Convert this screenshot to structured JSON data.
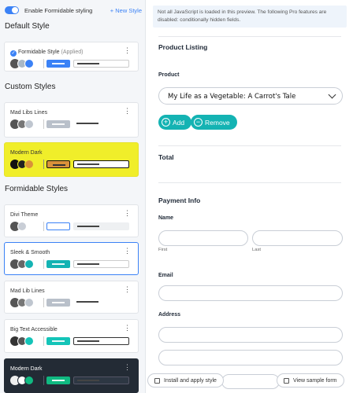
{
  "sidebar": {
    "toggle_label": "Enable Formidable styling",
    "new_style": "+ New Style",
    "default_title": "Default Style",
    "custom_title": "Custom Styles",
    "formidable_title": "Formidable Styles",
    "default_card": {
      "name": "Formidable Style",
      "applied": "(Applied)"
    },
    "custom_cards": [
      {
        "name": "Mad Libs Lines"
      },
      {
        "name": "Modern Dark"
      }
    ],
    "formidable_cards": [
      {
        "name": "Divi Theme"
      },
      {
        "name": "Sleek & Smooth"
      },
      {
        "name": "Mad Lib Lines"
      },
      {
        "name": "Big Text Accessible"
      },
      {
        "name": "Modern Dark"
      }
    ],
    "colors": {
      "highlight": "#f0ee2a",
      "accent": "#3b82f6",
      "teal": "#14b3b3",
      "dark_card": "#232b35"
    }
  },
  "preview": {
    "notice": "Not all JavaScript is loaded in this preview. The following Pro features are disabled: conditionally hidden fields.",
    "product_listing": "Product Listing",
    "product_label": "Product",
    "product_value": "My Life as a Vegetable: A Carrot's Tale",
    "add_label": "Add",
    "remove_label": "Remove",
    "total": "Total",
    "payment_info": "Payment Info",
    "name_label": "Name",
    "first": "First",
    "last": "Last",
    "email_label": "Email",
    "address_label": "Address"
  },
  "actions": {
    "install": "Install and apply style",
    "view_sample": "View sample form"
  }
}
